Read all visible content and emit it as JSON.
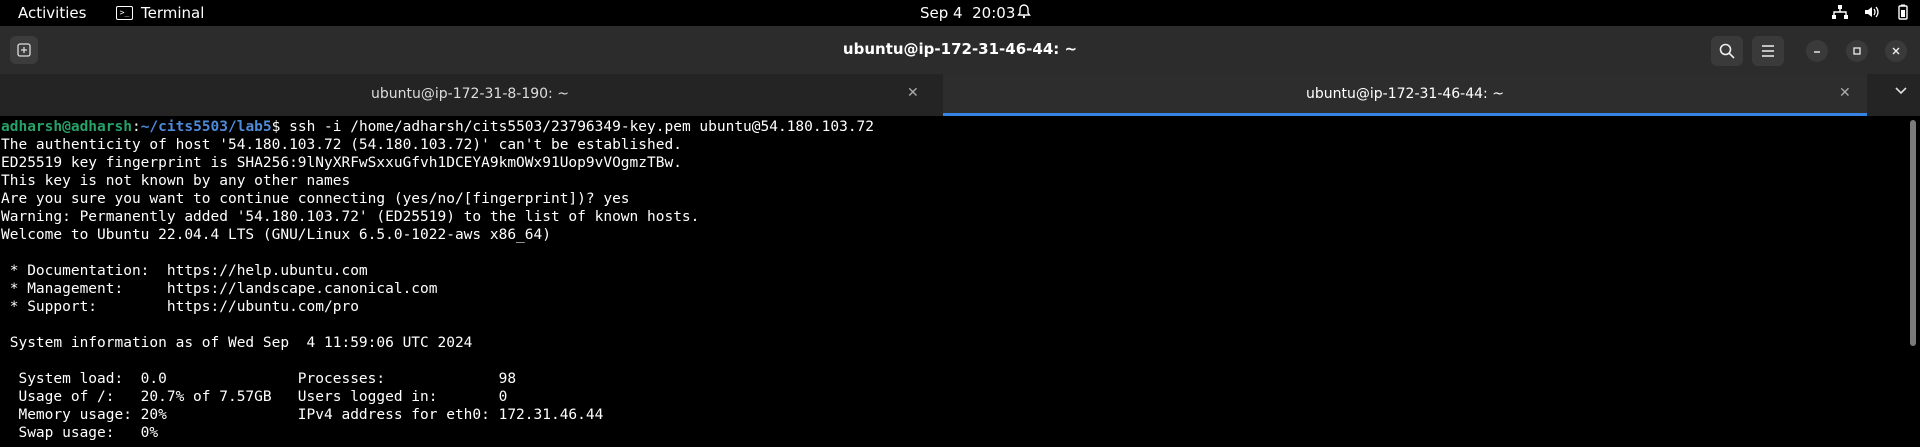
{
  "topbar": {
    "activities": "Activities",
    "app_name": "Terminal",
    "date": "Sep 4",
    "time": "20:03"
  },
  "window": {
    "title": "ubuntu@ip-172-31-46-44: ~"
  },
  "tabs": [
    {
      "label": "ubuntu@ip-172-31-8-190: ~",
      "active": false
    },
    {
      "label": "ubuntu@ip-172-31-46-44: ~",
      "active": true
    }
  ],
  "terminal": {
    "prompt_user": "adharsh@adharsh",
    "prompt_path": "~/cits5503/lab5",
    "command": "ssh -i /home/adharsh/cits5503/23796349-key.pem ubuntu@54.180.103.72",
    "output": [
      "The authenticity of host '54.180.103.72 (54.180.103.72)' can't be established.",
      "ED25519 key fingerprint is SHA256:9lNyXRFwSxxuGfvh1DCEYA9kmOWx91Uop9vVOgmzTBw.",
      "This key is not known by any other names",
      "Are you sure you want to continue connecting (yes/no/[fingerprint])? yes",
      "Warning: Permanently added '54.180.103.72' (ED25519) to the list of known hosts.",
      "Welcome to Ubuntu 22.04.4 LTS (GNU/Linux 6.5.0-1022-aws x86_64)",
      "",
      " * Documentation:  https://help.ubuntu.com",
      " * Management:     https://landscape.canonical.com",
      " * Support:        https://ubuntu.com/pro",
      "",
      " System information as of Wed Sep  4 11:59:06 UTC 2024",
      "",
      "  System load:  0.0               Processes:             98",
      "  Usage of /:   20.7% of 7.57GB   Users logged in:       0",
      "  Memory usage: 20%               IPv4 address for eth0: 172.31.46.44",
      "  Swap usage:   0%"
    ]
  },
  "colors": {
    "accent": "#3584e4",
    "prompt_user": "#26a269",
    "prompt_path": "#4d8ad8"
  },
  "icons": {
    "new_tab": "new-tab-icon",
    "search": "search-icon",
    "menu": "hamburger-menu-icon",
    "minimize": "minimize-icon",
    "maximize": "maximize-icon",
    "close": "close-icon"
  }
}
